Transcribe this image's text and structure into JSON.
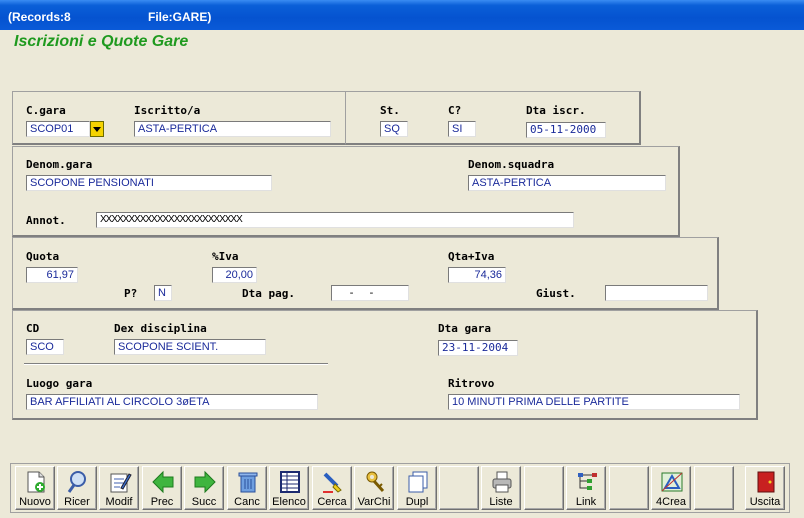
{
  "window": {
    "records": "(Records:8",
    "file": "File:GARE)"
  },
  "app_title": "Iscrizioni e Quote Gare",
  "form": {
    "cgara": {
      "label": "C.gara",
      "value": "SCOP01"
    },
    "iscritto": {
      "label": "Iscritto/a",
      "value": "ASTA-PERTICA"
    },
    "st": {
      "label": "St.",
      "value": "SQ"
    },
    "c": {
      "label": "C?",
      "value": "SI"
    },
    "dta_iscr": {
      "label": "Dta iscr.",
      "value": "05-11-2000"
    },
    "denom_gara": {
      "label": "Denom.gara",
      "value": "SCOPONE PENSIONATI"
    },
    "denom_squadra": {
      "label": "Denom.squadra",
      "value": "ASTA-PERTICA"
    },
    "annot": {
      "label": "Annot.",
      "value": "XXXXXXXXXXXXXXXXXXXXXXXXX"
    },
    "quota": {
      "label": "Quota",
      "value": "61,97"
    },
    "iva": {
      "label": "%Iva",
      "value": "20,00"
    },
    "qta_iva": {
      "label": "Qta+Iva",
      "value": "74,36"
    },
    "p": {
      "label": "P?",
      "value": "N"
    },
    "dta_pag": {
      "label": "Dta pag.",
      "value": "  -  -"
    },
    "giust": {
      "label": "Giust.",
      "value": ""
    },
    "cd": {
      "label": "CD",
      "value": "SCO"
    },
    "dex_disciplina": {
      "label": "Dex disciplina",
      "value": "SCOPONE SCIENT."
    },
    "dta_gara": {
      "label": "Dta gara",
      "value": "23-11-2004"
    },
    "luogo_gara": {
      "label": "Luogo gara",
      "value": "BAR AFFILIATI AL CIRCOLO 3øETA"
    },
    "ritrovo": {
      "label": "Ritrovo",
      "value": "10 MINUTI PRIMA DELLE PARTITE"
    }
  },
  "toolbar": {
    "nuovo": "Nuovo",
    "ricer": "Ricer",
    "modif": "Modif",
    "prec": "Prec",
    "succ": "Succ",
    "canc": "Canc",
    "elenco": "Elenco",
    "cerca": "Cerca",
    "varchi": "VarChi",
    "dupl": "Dupl",
    "blank1": "",
    "liste": "Liste",
    "blank2": "",
    "link": "Link",
    "blank3": "",
    "crea": "4Crea",
    "blank4": "",
    "uscita": "Uscita"
  },
  "colors": {
    "title_green": "#1f9a1f",
    "field_text": "#1a2a9a",
    "titlebar_blue": "#0553d0",
    "dropdown_yellow": "#f5d300"
  }
}
